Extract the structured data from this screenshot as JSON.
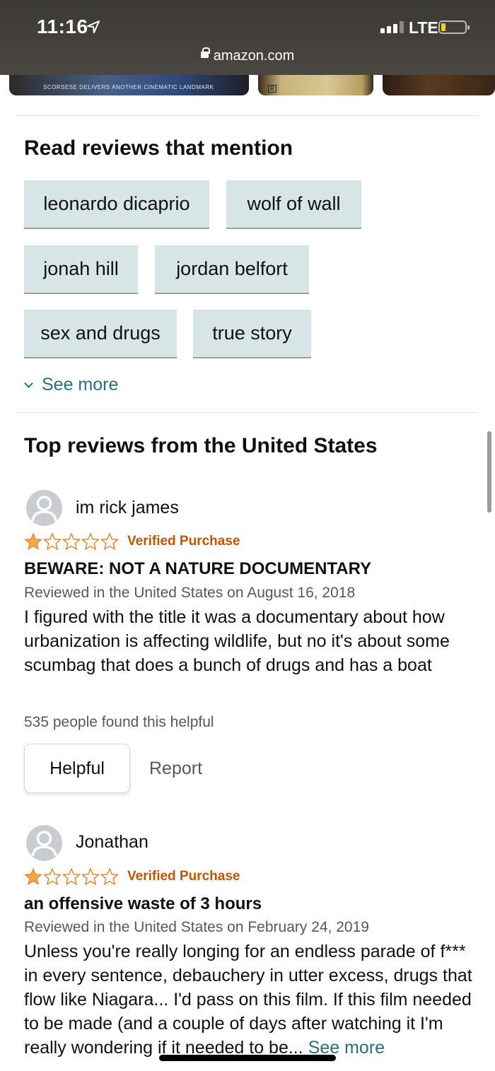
{
  "status_bar": {
    "time": "11:16",
    "network": "LTE",
    "url": "amazon.com"
  },
  "poster": {
    "tagline": "SCORSESE DELIVERS ANOTHER CINEMATIC LANDMARK",
    "rating_mark": "R"
  },
  "mentions": {
    "title": "Read reviews that mention",
    "chips": [
      "leonardo dicaprio",
      "wolf of wall",
      "jonah hill",
      "jordan belfort",
      "sex and drugs",
      "true story"
    ],
    "see_more": "See more"
  },
  "top_reviews": {
    "title": "Top reviews from the United States",
    "reviews": [
      {
        "reviewer": "im rick james",
        "rating": 1,
        "verified": "Verified Purchase",
        "title": "BEWARE: NOT A NATURE DOCUMENTARY",
        "meta": "Reviewed in the United States on August 16, 2018",
        "body": "I figured with the title it was a documentary about how urbanization is affecting wildlife, but no it's about some scumbag that does a bunch of drugs and has a boat",
        "helpful_count": "535 people found this helpful",
        "helpful_label": "Helpful",
        "report_label": "Report"
      },
      {
        "reviewer": "Jonathan",
        "rating": 1,
        "verified": "Verified Purchase",
        "title": "an offensive waste of 3 hours",
        "meta": "Reviewed in the United States on February 24, 2019",
        "body": "Unless you're really longing for an endless parade of f*** in every sentence, debauchery in utter excess, drugs that flow like Niagara... I'd pass on this film. If this film needed to be made (and a couple of days after watching it I'm really wondering if it needed to be...",
        "see_more": "See more"
      }
    ]
  },
  "colors": {
    "chip_bg": "#d7e5e6",
    "link": "#2d6f78",
    "verified": "#c45500",
    "star": "#f3a847"
  }
}
